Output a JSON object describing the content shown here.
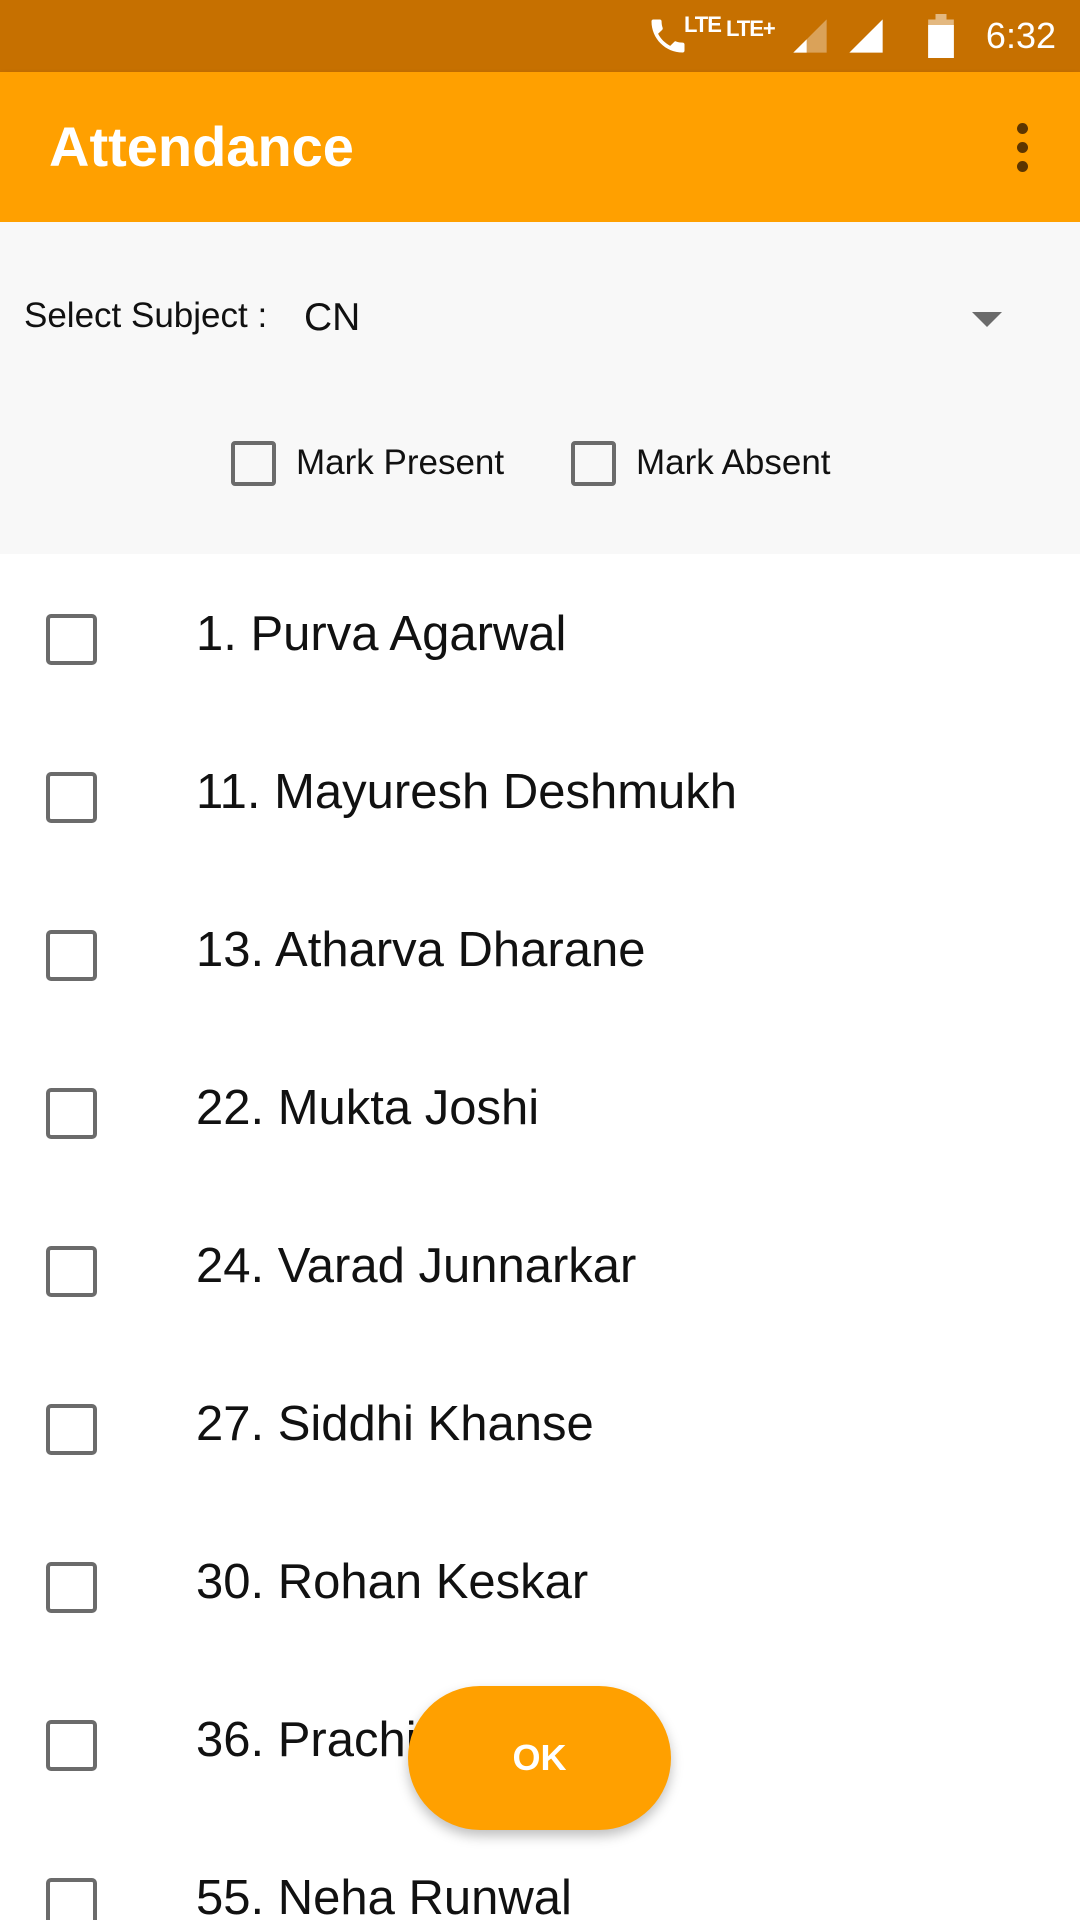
{
  "status_bar": {
    "time": "6:32",
    "call_lte_label": "LTE",
    "network_label": "LTE+",
    "icons": [
      "wifi-calling-icon",
      "signal-weak-icon",
      "signal-full-icon",
      "battery-icon"
    ]
  },
  "toolbar": {
    "title": "Attendance",
    "menu_icon": "overflow-menu-icon"
  },
  "filter": {
    "subject_label": "Select Subject :",
    "subject_value": "CN",
    "mark_present_label": "Mark Present",
    "mark_absent_label": "Mark Absent",
    "mark_present_checked": false,
    "mark_absent_checked": false
  },
  "students": [
    {
      "label": "1. Purva Agarwal",
      "checked": false
    },
    {
      "label": "11. Mayuresh Deshmukh",
      "checked": false
    },
    {
      "label": "13. Atharva Dharane",
      "checked": false
    },
    {
      "label": "22. Mukta Joshi",
      "checked": false
    },
    {
      "label": "24. Varad Junnarkar",
      "checked": false
    },
    {
      "label": "27. Siddhi Khanse",
      "checked": false
    },
    {
      "label": "30. Rohan Keskar",
      "checked": false
    },
    {
      "label": "36. Prachi",
      "checked": false
    },
    {
      "label": "55. Neha Runwal",
      "checked": false
    }
  ],
  "fab": {
    "label": "OK"
  },
  "colors": {
    "status_bar": "#c67000",
    "accent": "#ffa000",
    "panel_bg": "#f8f8f8",
    "checkbox_border": "#6b6b6b"
  }
}
